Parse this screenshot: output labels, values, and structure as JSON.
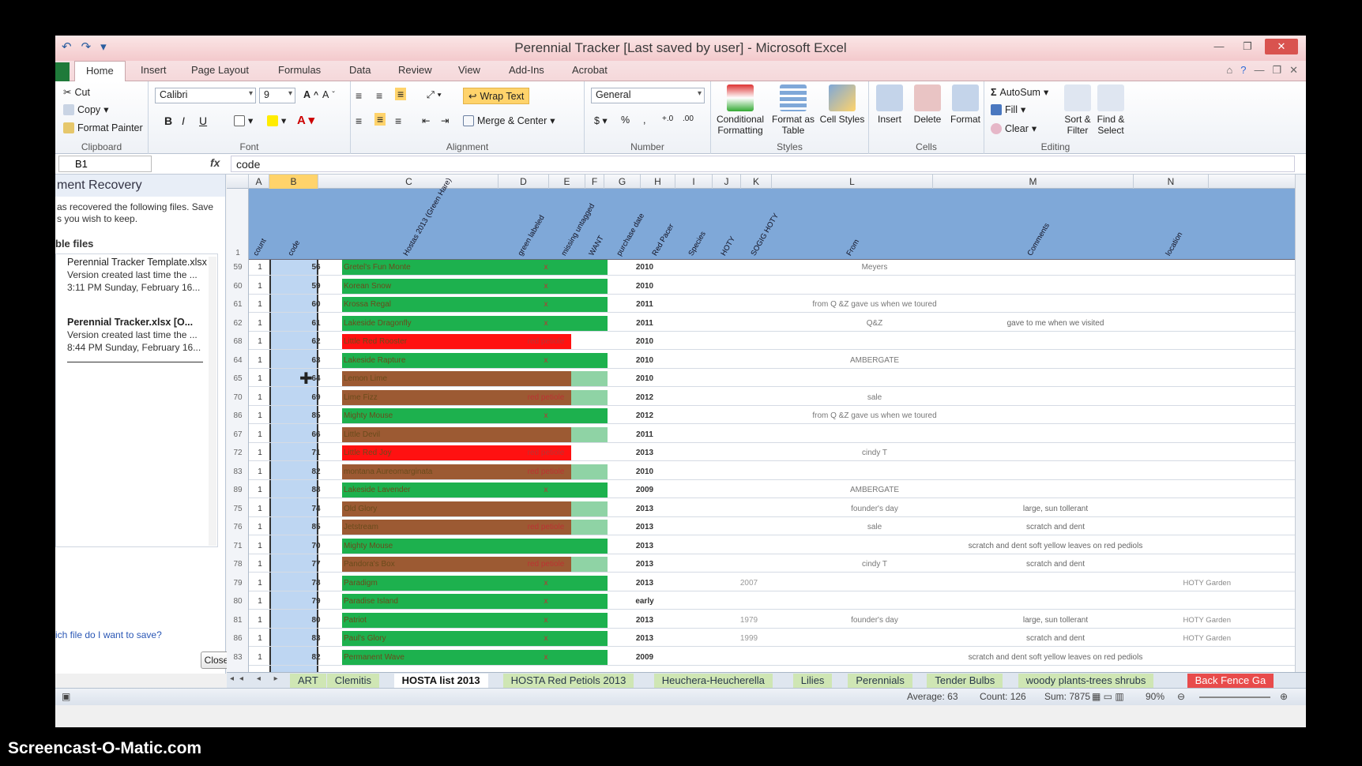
{
  "window": {
    "title": "Perennial Tracker [Last saved by user]  -  Microsoft Excel"
  },
  "tabs": [
    "Home",
    "Insert",
    "Page Layout",
    "Formulas",
    "Data",
    "Review",
    "View",
    "Add-Ins",
    "Acrobat"
  ],
  "clipboard": {
    "cut": "Cut",
    "copy": "Copy",
    "format_painter": "Format Painter",
    "label": "Clipboard"
  },
  "font": {
    "name": "Calibri",
    "size": "9",
    "label": "Font"
  },
  "alignment": {
    "wrap": "Wrap Text",
    "merge": "Merge & Center",
    "label": "Alignment"
  },
  "number": {
    "format": "General",
    "label": "Number"
  },
  "styles": {
    "conditional": "Conditional Formatting",
    "table": "Format as Table",
    "cell": "Cell Styles",
    "label": "Styles"
  },
  "cells": {
    "insert": "Insert",
    "delete": "Delete",
    "format": "Format",
    "label": "Cells"
  },
  "editing": {
    "autosum": "AutoSum",
    "fill": "Fill",
    "clear": "Clear",
    "sort": "Sort & Filter",
    "find": "Find & Select",
    "label": "Editing"
  },
  "formula_bar": {
    "name_box": "B1",
    "content": "code"
  },
  "recovery": {
    "title": "ment Recovery",
    "desc": "as recovered the following files.  Save\ns you wish to keep.",
    "files_heading": "ble files",
    "files": [
      {
        "name": "Perennial Tracker Template.xlsx",
        "line2": "Version created last time the ...",
        "line3": "3:11 PM Sunday, February 16..."
      },
      {
        "name": "Perennial Tracker.xlsx  [O...",
        "line2": "Version created last time the ...",
        "line3": "8:44 PM Sunday, February 16..."
      }
    ],
    "link": "ich file do I want to save?",
    "close": "Close"
  },
  "columns": [
    "A",
    "B",
    "C",
    "D",
    "E",
    "F",
    "G",
    "H",
    "I",
    "J",
    "K",
    "L",
    "M",
    "N"
  ],
  "header_labels": [
    "count",
    "code",
    "Hostas 2013 (Green Hare)",
    "green labeled",
    "missing untagged",
    "WANT",
    "purchase date",
    "Red Pacer",
    "Species",
    "HOTY",
    "SOGIG HOTY",
    "From",
    "Comments",
    "location"
  ],
  "header_row_number": "1",
  "rows": [
    {
      "r": "59",
      "a": "1",
      "b": "56",
      "c": "Gretel's Fun Monte",
      "d": "x",
      "fill": "green",
      "g": "2010",
      "l": "Meyers",
      "m": "",
      "n": ""
    },
    {
      "r": "60",
      "a": "1",
      "b": "59",
      "c": "Korean Snow",
      "d": "x",
      "fill": "green",
      "g": "2010",
      "l": "",
      "m": "",
      "n": ""
    },
    {
      "r": "61",
      "a": "1",
      "b": "60",
      "c": "Krossa Regal",
      "d": "x",
      "fill": "green",
      "g": "2011",
      "l": "from Q &Z gave us when we toured",
      "m": "",
      "n": ""
    },
    {
      "r": "62",
      "a": "1",
      "b": "61",
      "c": "Lakeside Dragonfly",
      "d": "x",
      "fill": "green",
      "g": "2011",
      "l": "Q&Z",
      "m": "gave to me when we visited",
      "n": ""
    },
    {
      "r": "68",
      "a": "1",
      "b": "62",
      "c": "Little Red Rooster",
      "d": "red petiole",
      "fill": "red",
      "g": "2010",
      "l": "",
      "m": "",
      "n": ""
    },
    {
      "r": "64",
      "a": "1",
      "b": "63",
      "c": "Lakeside Rapture",
      "d": "x",
      "fill": "green",
      "g": "2010",
      "l": "AMBERGATE",
      "m": "",
      "n": ""
    },
    {
      "r": "65",
      "a": "1",
      "b": "64",
      "c": "Lemon Lime",
      "d": "",
      "fill": "brown",
      "g": "2010",
      "l": "",
      "m": "",
      "n": ""
    },
    {
      "r": "70",
      "a": "1",
      "b": "69",
      "c": "Lime Fizz",
      "d": "red petiole",
      "fill": "brown",
      "g": "2012",
      "l": "sale",
      "m": "",
      "n": ""
    },
    {
      "r": "86",
      "a": "1",
      "b": "85",
      "c": "Mighty Mouse",
      "d": "x",
      "fill": "green",
      "g": "2012",
      "l": "from Q &Z gave us when we toured",
      "m": "",
      "n": ""
    },
    {
      "r": "67",
      "a": "1",
      "b": "66",
      "c": "Little Devil",
      "d": "",
      "fill": "brown",
      "g": "2011",
      "l": "",
      "m": "",
      "n": ""
    },
    {
      "r": "72",
      "a": "1",
      "b": "71",
      "c": "Little Red Joy",
      "d": "red petiole",
      "fill": "red",
      "g": "2013",
      "l": "cindy T",
      "m": "",
      "n": ""
    },
    {
      "r": "83",
      "a": "1",
      "b": "82",
      "c": "montana Aureomarginata",
      "d": "red petiole",
      "fill": "brown",
      "g": "2010",
      "l": "",
      "m": "",
      "n": ""
    },
    {
      "r": "89",
      "a": "1",
      "b": "88",
      "c": "Lakeside Lavender",
      "d": "x",
      "fill": "green",
      "g": "2009",
      "l": "AMBERGATE",
      "m": "",
      "n": ""
    },
    {
      "r": "75",
      "a": "1",
      "b": "74",
      "c": "Old Glory",
      "d": "",
      "fill": "brown",
      "g": "2013",
      "l": "founder's day",
      "m": "large, sun tollerant",
      "n": ""
    },
    {
      "r": "76",
      "a": "1",
      "b": "85",
      "c": "Jetstream",
      "d": "red petiole",
      "fill": "brown",
      "g": "2013",
      "l": "sale",
      "m": "scratch and dent",
      "n": ""
    },
    {
      "r": "71",
      "a": "1",
      "b": "70",
      "c": "Mighty Mouse",
      "d": "",
      "fill": "green",
      "g": "2013",
      "l": "",
      "m": "scratch and dent soft yellow leaves on red pediols",
      "n": ""
    },
    {
      "r": "78",
      "a": "1",
      "b": "77",
      "c": "Pandora's Box",
      "d": "red petiole",
      "fill": "brown",
      "g": "2013",
      "l": "cindy T",
      "m": "scratch and dent",
      "n": ""
    },
    {
      "r": "79",
      "a": "1",
      "b": "78",
      "c": "Paradigm",
      "d": "x",
      "fill": "green",
      "g": "2013",
      "l": "",
      "m": "",
      "n": "HOTY Garden"
    },
    {
      "r": "80",
      "a": "1",
      "b": "79",
      "c": "Paradise Island",
      "d": "x",
      "fill": "green",
      "g": "early",
      "l": "",
      "m": "",
      "n": ""
    },
    {
      "r": "81",
      "a": "1",
      "b": "80",
      "c": "Patriot",
      "d": "x",
      "fill": "green",
      "g": "2013",
      "l": "founder's day",
      "m": "large, sun tollerant",
      "n": "HOTY Garden"
    },
    {
      "r": "86",
      "a": "1",
      "b": "83",
      "c": "Paul's Glory",
      "d": "x",
      "fill": "green",
      "g": "2013",
      "l": "",
      "m": "scratch and dent",
      "n": "HOTY Garden"
    },
    {
      "r": "83",
      "a": "1",
      "b": "82",
      "c": "Permanent Wave",
      "d": "x",
      "fill": "green",
      "g": "2009",
      "l": "",
      "m": "scratch and dent soft yellow leaves on red pediols",
      "n": ""
    }
  ],
  "hoty_years": {
    "r79": "2007",
    "r81": "1979",
    "r86": "1999"
  },
  "sheet_tabs": [
    "ART",
    "Clemitis",
    "HOSTA list 2013",
    "HOSTA Red Petiols 2013",
    "Heuchera-Heucherella",
    "Lilies",
    "Perennials",
    "Tender Bulbs",
    "woody plants-trees shrubs",
    "Back Fence Ga"
  ],
  "active_sheet": "HOSTA list 2013",
  "status": {
    "average": "Average: 63",
    "count": "Count: 126",
    "sum": "Sum: 7875",
    "zoom": "90%"
  },
  "watermark": "Screencast-O-Matic.com",
  "colors": {
    "green": "#1db14e",
    "red": "#ff1111",
    "brown": "#9c5a33",
    "header_blue": "#7fa8d8"
  }
}
